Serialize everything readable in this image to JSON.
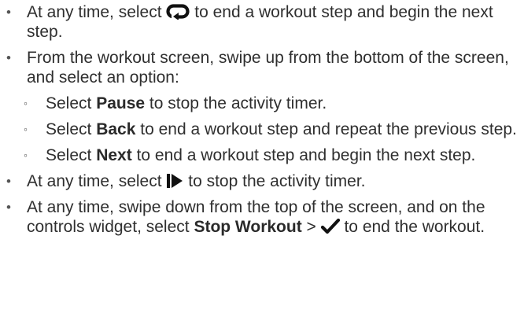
{
  "bullets": {
    "l1": "•",
    "l2": "◦"
  },
  "items": [
    {
      "before": "At any time, select ",
      "icon": "lap-loop-icon",
      "after": " to end a workout step and begin the next step."
    },
    {
      "text": "From the workout screen, swipe up from the bottom of the screen, and select an option:"
    },
    {
      "pre": "Select ",
      "bold": "Pause",
      "post": " to stop the activity timer."
    },
    {
      "pre": "Select ",
      "bold": "Back",
      "post": " to end a workout step and repeat the previous step."
    },
    {
      "pre": "Select ",
      "bold": "Next",
      "post": " to end a workout step and begin the next step."
    },
    {
      "before": "At any time, select ",
      "icon": "start-stop-icon",
      "after": " to stop the activity timer."
    },
    {
      "pre": "At any time, swipe down from the top of the screen, and on the controls widget, select ",
      "bold": "Stop Workout",
      "mid": " > ",
      "icon": "checkmark-icon",
      "post": " to end the workout."
    }
  ]
}
